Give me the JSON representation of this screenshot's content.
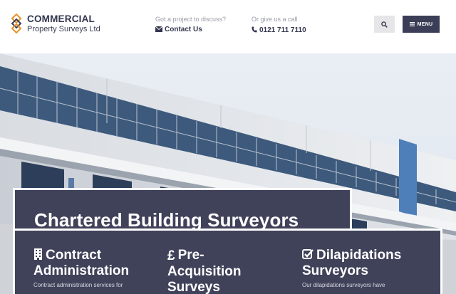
{
  "header": {
    "brand_line1": "COMMERCIAL",
    "brand_line2": "Property Surveys Ltd",
    "project_prompt": "Got a project to discuss?",
    "contact_label": "Contact Us",
    "call_prompt": "Or give us a call",
    "phone": "0121 711 7110",
    "menu_label": "MENU"
  },
  "hero": {
    "heading": "Chartered Building Surveyors"
  },
  "services": [
    {
      "icon": "building-icon",
      "line1": "Contract",
      "line2": "Administration",
      "line3": "",
      "desc": "Contract administration services for"
    },
    {
      "icon": "pound-icon",
      "line1": "Pre-",
      "line2": "Acquisition",
      "line3": "Surveys",
      "desc": ""
    },
    {
      "icon": "checkbox-icon",
      "line1": "Dilapidations",
      "line2": "Surveyors",
      "line3": "",
      "desc": "Our dilapidations surveyors have"
    }
  ],
  "colors": {
    "brand_navy": "#40425a",
    "logo_orange": "#e8922a",
    "header_text": "#33364f"
  }
}
